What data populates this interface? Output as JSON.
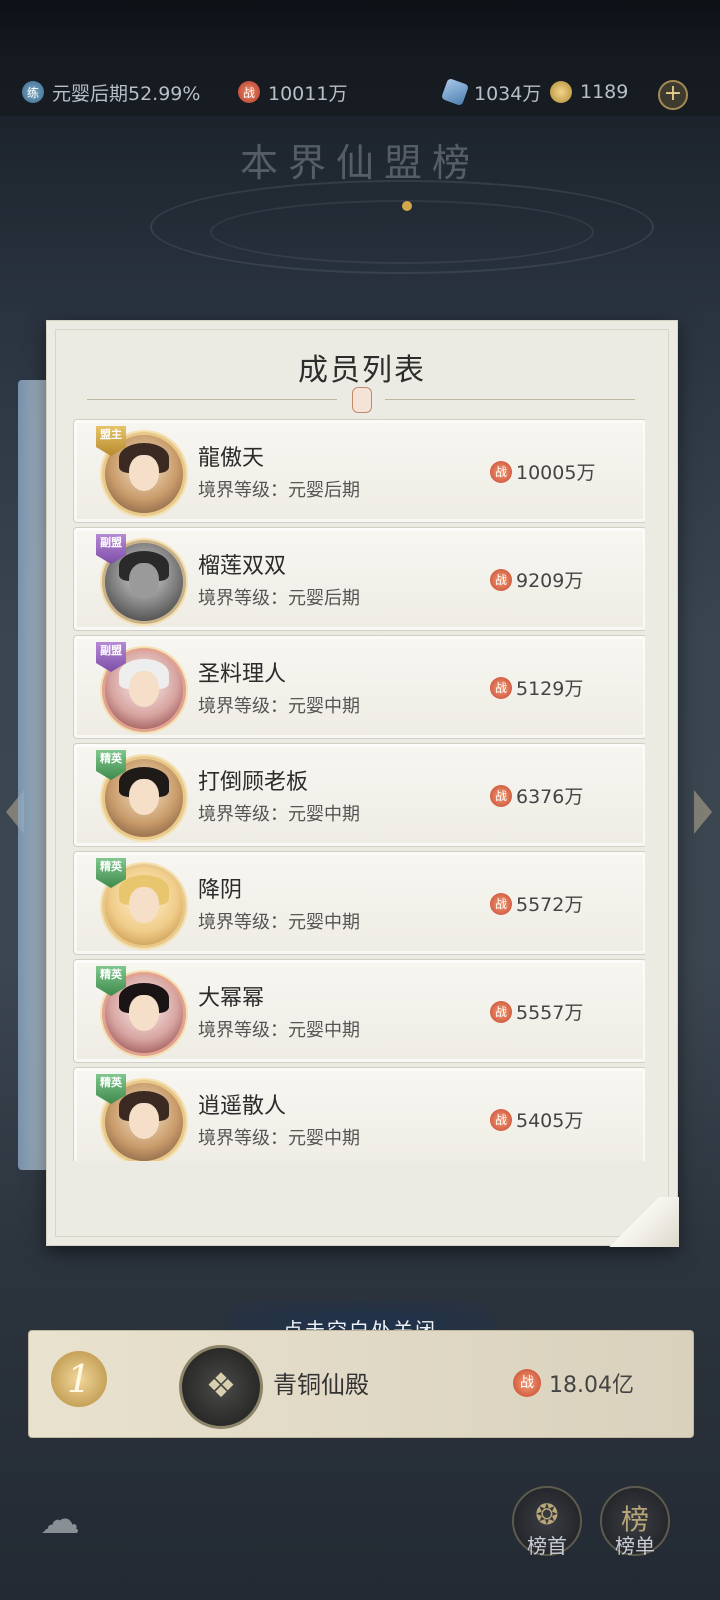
{
  "resources": {
    "realm_progress": "元婴后期52.99%",
    "power": "10011万",
    "crystals": "1034万",
    "coins": "1189"
  },
  "background_title": "本界仙盟榜",
  "panel": {
    "title": "成员列表",
    "realm_prefix": "境界等级：",
    "members": [
      {
        "badge": "盟主",
        "role": "leader",
        "name": "龍傲天",
        "realm": "境界等级：元婴后期",
        "power": "10005万"
      },
      {
        "badge": "副盟",
        "role": "vice",
        "name": "榴莲双双",
        "realm": "境界等级：元婴后期",
        "power": "9209万"
      },
      {
        "badge": "副盟",
        "role": "vice",
        "name": "圣料理人",
        "realm": "境界等级：元婴中期",
        "power": "5129万"
      },
      {
        "badge": "精英",
        "role": "elite",
        "name": "打倒顾老板",
        "realm": "境界等级：元婴中期",
        "power": "6376万"
      },
      {
        "badge": "精英",
        "role": "elite",
        "name": "降阴",
        "realm": "境界等级：元婴中期",
        "power": "5572万"
      },
      {
        "badge": "精英",
        "role": "elite",
        "name": "大幂幂",
        "realm": "境界等级：元婴中期",
        "power": "5557万"
      },
      {
        "badge": "精英",
        "role": "elite",
        "name": "逍遥散人",
        "realm": "境界等级：元婴中期",
        "power": "5405万"
      }
    ]
  },
  "close_hint": "点击空白处关闭",
  "guild_rank": {
    "rank": "1",
    "name": "青铜仙殿",
    "power": "18.04亿"
  },
  "bottom_buttons": {
    "btn1_label": "榜首",
    "btn2_label": "榜单",
    "btn2_glyph": "榜"
  },
  "icons": {
    "power_glyph": "战",
    "realm_glyph": "练"
  },
  "colors": {
    "panel_bg": "#ecebe3",
    "power_red": "#c6442c",
    "gold": "#d3a84a"
  }
}
